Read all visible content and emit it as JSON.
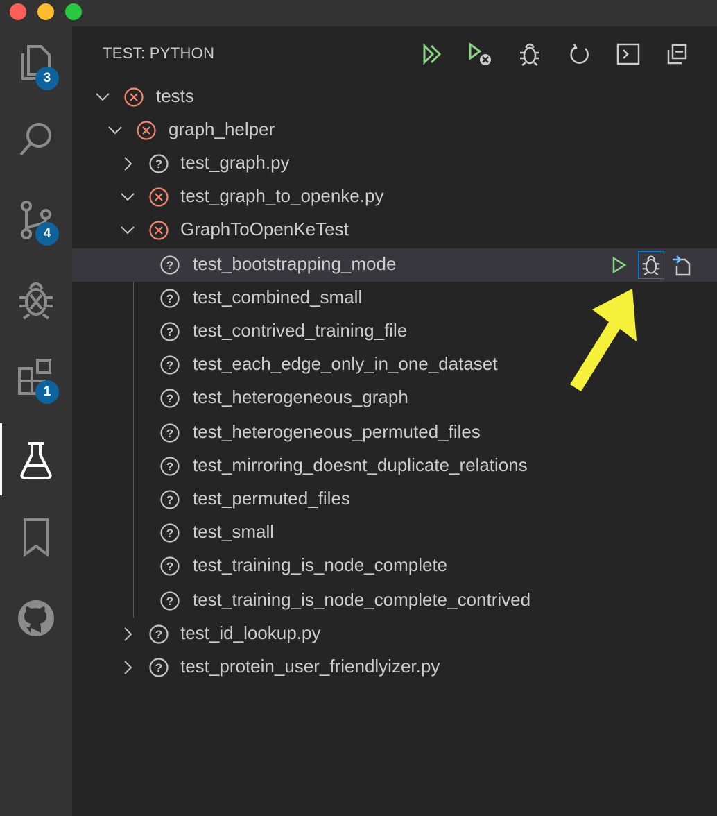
{
  "window": {
    "traffic_lights": {
      "close": "#ff5f57",
      "minimize": "#febc2e",
      "zoom": "#28c840"
    }
  },
  "activity_bar": {
    "items": [
      {
        "name": "explorer",
        "icon": "files-icon",
        "badge": "3"
      },
      {
        "name": "search",
        "icon": "search-icon",
        "badge": ""
      },
      {
        "name": "source-control",
        "icon": "source-control-icon",
        "badge": "4"
      },
      {
        "name": "debug",
        "icon": "debug-icon",
        "badge": ""
      },
      {
        "name": "extensions",
        "icon": "extensions-icon",
        "badge": "1"
      },
      {
        "name": "test",
        "icon": "flask-icon",
        "badge": "",
        "active": true
      },
      {
        "name": "bookmarks",
        "icon": "bookmark-icon",
        "badge": ""
      },
      {
        "name": "github",
        "icon": "github-icon",
        "badge": ""
      }
    ]
  },
  "panel": {
    "title": "TEST: PYTHON",
    "toolbar": [
      {
        "name": "run-all-tests",
        "icon": "run-all-icon"
      },
      {
        "name": "run-failed-tests",
        "icon": "run-failed-icon"
      },
      {
        "name": "debug-tests",
        "icon": "debug-icon"
      },
      {
        "name": "refresh-tests",
        "icon": "refresh-icon"
      },
      {
        "name": "show-output",
        "icon": "terminal-icon"
      },
      {
        "name": "collapse-all",
        "icon": "collapse-all-icon"
      }
    ]
  },
  "tree": [
    {
      "label": "tests",
      "status": "failed",
      "expanded": true
    },
    {
      "label": "graph_helper",
      "status": "failed",
      "expanded": true
    },
    {
      "label": "test_graph.py",
      "status": "unknown",
      "expanded": false
    },
    {
      "label": "test_graph_to_openke.py",
      "status": "failed",
      "expanded": true
    },
    {
      "label": "GraphToOpenKeTest",
      "status": "failed",
      "expanded": true
    },
    {
      "label": "test_bootstrapping_mode",
      "status": "unknown",
      "selected": true
    },
    {
      "label": "test_combined_small",
      "status": "unknown"
    },
    {
      "label": "test_contrived_training_file",
      "status": "unknown"
    },
    {
      "label": "test_each_edge_only_in_one_dataset",
      "status": "unknown"
    },
    {
      "label": "test_heterogeneous_graph",
      "status": "unknown"
    },
    {
      "label": "test_heterogeneous_permuted_files",
      "status": "unknown"
    },
    {
      "label": "test_mirroring_doesnt_duplicate_relations",
      "status": "unknown"
    },
    {
      "label": "test_permuted_files",
      "status": "unknown"
    },
    {
      "label": "test_small",
      "status": "unknown"
    },
    {
      "label": "test_training_is_node_complete",
      "status": "unknown"
    },
    {
      "label": "test_training_is_node_complete_contrived",
      "status": "unknown"
    },
    {
      "label": "test_id_lookup.py",
      "status": "unknown",
      "expanded": false
    },
    {
      "label": "test_protein_user_friendlyizer.py",
      "status": "unknown",
      "expanded": false
    }
  ],
  "row_actions": [
    {
      "name": "run-test",
      "icon": "play-icon"
    },
    {
      "name": "debug-test",
      "icon": "debug-icon",
      "focused": true
    },
    {
      "name": "go-to-test",
      "icon": "go-to-file-icon"
    }
  ],
  "colors": {
    "failed": "#f48771",
    "unknown": "#c5c5c5",
    "run": "#89d185",
    "badge": "#0e639c",
    "focus": "#007acc",
    "annotation_arrow": "#f5f03a"
  }
}
